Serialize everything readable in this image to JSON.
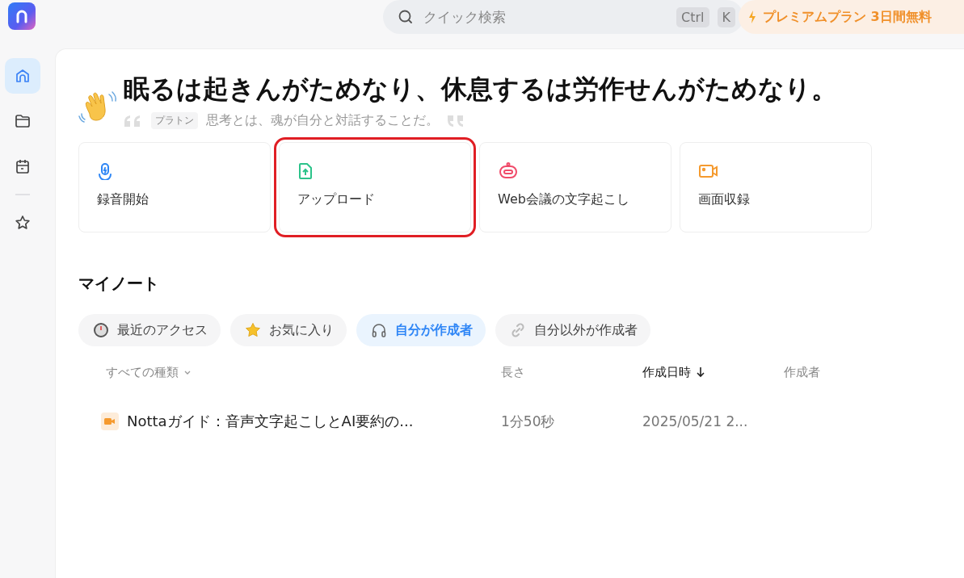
{
  "search": {
    "placeholder": "クイック検索",
    "keys": [
      "Ctrl",
      "K"
    ]
  },
  "promo": {
    "text": "プレミアムプラン 3日間無料"
  },
  "sidebar": {
    "items": [
      {
        "kind": "home",
        "selected": true
      },
      {
        "kind": "folder",
        "selected": false
      },
      {
        "kind": "calendar",
        "selected": false
      },
      {
        "kind": "divider"
      },
      {
        "kind": "star",
        "selected": false
      }
    ]
  },
  "greeting": {
    "title": "眠るは起きんがためなり、休息するは労作せんがためなり。",
    "author": "プラトン",
    "quote": "思考とは、魂が自分と対話することだ。"
  },
  "actions": [
    {
      "kind": "record",
      "label": "録音開始",
      "highlighted": false
    },
    {
      "kind": "upload",
      "label": "アップロード",
      "highlighted": true
    },
    {
      "kind": "meeting",
      "label": "Web会議の文字起こし",
      "highlighted": false
    },
    {
      "kind": "screen",
      "label": "画面収録",
      "highlighted": false
    }
  ],
  "notes": {
    "heading": "マイノート",
    "tabs": [
      {
        "kind": "recent",
        "label": "最近のアクセス",
        "selected": false
      },
      {
        "kind": "favorite",
        "label": "お気に入り",
        "selected": false
      },
      {
        "kind": "mine",
        "label": "自分が作成者",
        "selected": true
      },
      {
        "kind": "others",
        "label": "自分以外が作成者",
        "selected": false
      }
    ],
    "columns": [
      {
        "label": "すべての種類",
        "sorted": false,
        "dropdown": true
      },
      {
        "label": "長さ",
        "sorted": false,
        "dropdown": false
      },
      {
        "label": "作成日時",
        "sorted": true,
        "dropdown": false
      },
      {
        "label": "作成者",
        "sorted": false,
        "dropdown": false
      }
    ],
    "rows": [
      {
        "title": "Nottaガイド：音声文字起こしとAI要約の...",
        "length": "1分50秒",
        "created": "2025/05/21 2..."
      }
    ]
  }
}
